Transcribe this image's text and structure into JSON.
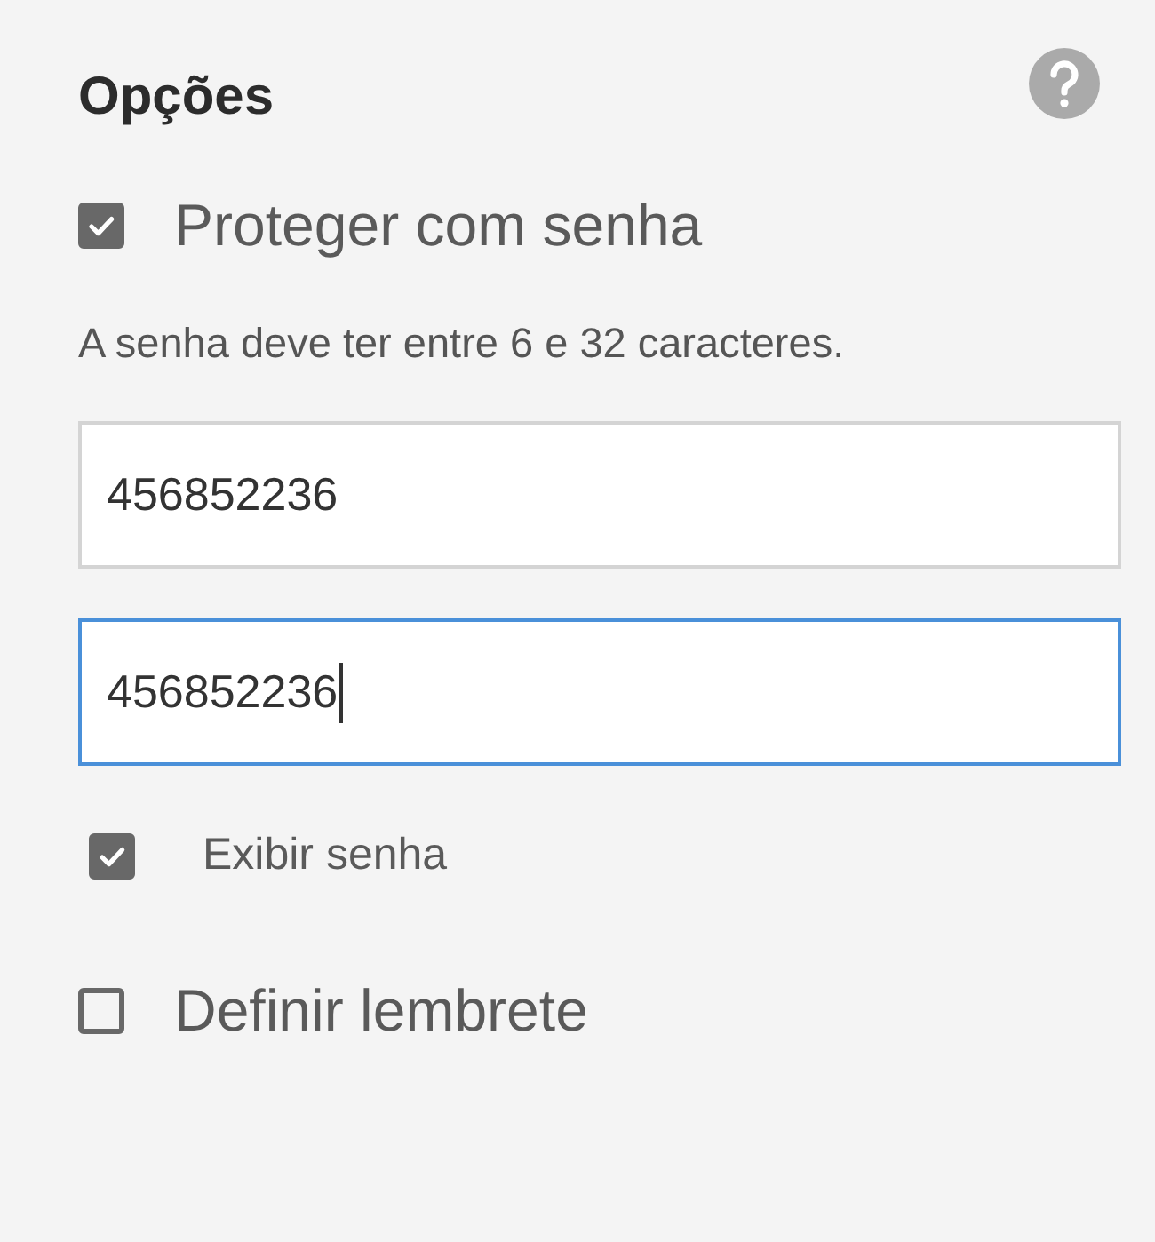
{
  "title": "Opções",
  "protect": {
    "label": "Proteger com senha",
    "checked": true
  },
  "hint": "A senha deve ter entre 6 e 32 caracteres.",
  "fields": [
    {
      "value": "456852236",
      "focused": false
    },
    {
      "value": "456852236",
      "focused": true
    }
  ],
  "show_password": {
    "label": "Exibir senha",
    "checked": true
  },
  "reminder": {
    "label": "Definir lembrete",
    "checked": false
  }
}
